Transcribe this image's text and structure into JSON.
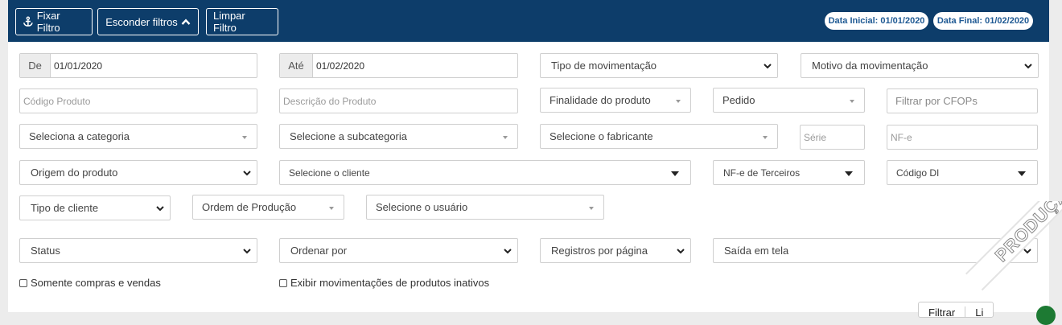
{
  "toolbar": {
    "fix_filter": "Fixar Filtro",
    "hide_filters": "Esconder filtros",
    "clear_filter": "Limpar Filtro",
    "date_start_badge": "Data Inicial: 01/01/2020",
    "date_end_badge": "Data Final: 01/02/2020"
  },
  "filters": {
    "date_from_label": "De",
    "date_from_value": "01/01/2020",
    "date_to_label": "Até",
    "date_to_value": "01/02/2020",
    "movement_type": "Tipo de movimentação",
    "movement_reason": "Motivo da movimentação",
    "product_code_placeholder": "Código Produto",
    "product_description_placeholder": "Descrição do Produto",
    "product_purpose": "Finalidade do produto",
    "order": "Pedido",
    "cfop_placeholder": "Filtrar por CFOPs",
    "category": "Seleciona a categoria",
    "subcategory": "Selecione a subcategoria",
    "manufacturer": "Selecione o fabricante",
    "series_placeholder": "Série",
    "nfe_placeholder": "NF-e",
    "product_origin": "Origem do produto",
    "client": "Selecione o cliente",
    "third_party_nfe": "NF-e de Terceiros",
    "di_code": "Código DI",
    "client_type": "Tipo de cliente",
    "production_order": "Ordem de Produção",
    "user": "Selecione o usuário",
    "status": "Status",
    "sort_by": "Ordenar por",
    "records_per_page": "Registros por página",
    "output": "Saída em tela",
    "only_purchases_sales": "Somente compras e vendas",
    "show_inactive_movements": "Exibir movimentações de produtos inativos"
  },
  "actions": {
    "filter": "Filtrar",
    "clear_partial": "Li"
  },
  "ribbon": {
    "text": "PRODUÇÃO"
  },
  "colors": {
    "topbar": "#0d3d6a",
    "badge_text": "#1f5a94",
    "accent_green": "#1d7a33"
  }
}
